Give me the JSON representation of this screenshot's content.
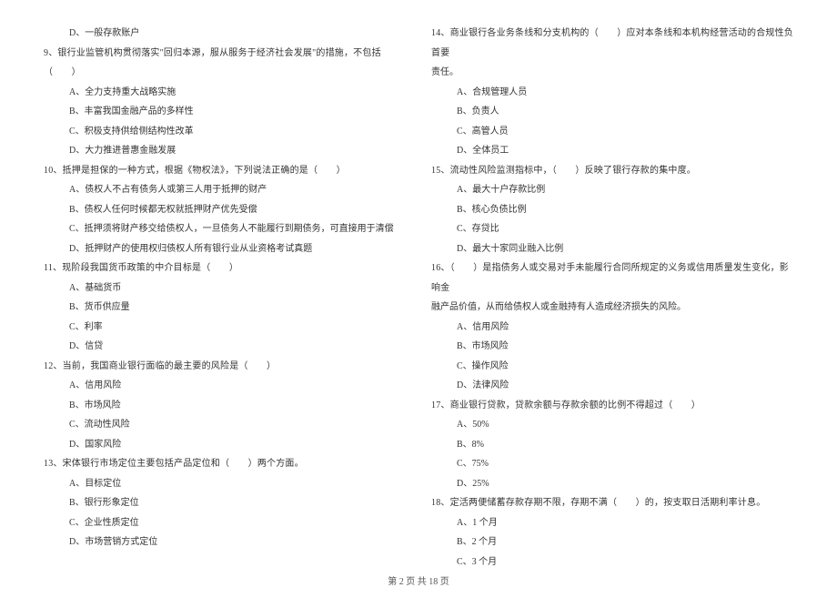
{
  "leftCol": {
    "preOption": "D、一般存款账户",
    "questions": [
      {
        "num": "9、",
        "text": "银行业监管机构贯彻落实\"回归本源，服从服务于经济社会发展\"的措施，不包括（　　）",
        "options": [
          "A、全力支持重大战略实施",
          "B、丰富我国金融产品的多样性",
          "C、积极支持供给侧结构性改革",
          "D、大力推进普惠金融发展"
        ]
      },
      {
        "num": "10、",
        "text": "抵押是担保的一种方式，根据《物权法》，下列说法正确的是（　　）",
        "options": [
          "A、债权人不占有债务人或第三人用于抵押的财产",
          "B、债权人任何时候都无权就抵押财产优先受偿",
          "C、抵押须将财产移交给债权人，一旦债务人不能履行到期债务，可直接用于清偿",
          "D、抵押财产的使用权归债权人所有银行业从业资格考试真题"
        ]
      },
      {
        "num": "11、",
        "text": "现阶段我国货币政策的中介目标是（　　）",
        "options": [
          "A、基础货币",
          "B、货币供应量",
          "C、利率",
          "D、信贷"
        ]
      },
      {
        "num": "12、",
        "text": "当前，我国商业银行面临的最主要的风险是（　　）",
        "options": [
          "A、信用风险",
          "B、市场风险",
          "C、流动性风险",
          "D、国家风险"
        ]
      },
      {
        "num": "13、",
        "text": "宋体银行市场定位主要包括产品定位和（　　）两个方面。",
        "options": [
          "A、目标定位",
          "B、银行形象定位",
          "C、企业性质定位",
          "D、市场营销方式定位"
        ]
      }
    ]
  },
  "rightCol": {
    "questions": [
      {
        "num": "14、",
        "text": "商业银行各业务条线和分支机构的（　　）应对本条线和本机构经营活动的合规性负首要",
        "cont": "责任。",
        "options": [
          "A、合规管理人员",
          "B、负责人",
          "C、高管人员",
          "D、全体员工"
        ]
      },
      {
        "num": "15、",
        "text": "流动性风险监测指标中，（　　）反映了银行存款的集中度。",
        "options": [
          "A、最大十户存款比例",
          "B、核心负债比例",
          "C、存贷比",
          "D、最大十家同业融入比例"
        ]
      },
      {
        "num": "16、",
        "text": "（　　）是指债务人或交易对手未能履行合同所规定的义务或信用质量发生变化，影响金",
        "cont": "融产品价值，从而给债权人或金融持有人造成经济损失的风险。",
        "options": [
          "A、信用风险",
          "B、市场风险",
          "C、操作风险",
          "D、法律风险"
        ]
      },
      {
        "num": "17、",
        "text": "商业银行贷款，贷款余额与存款余额的比例不得超过（　　）",
        "options": [
          "A、50%",
          "B、8%",
          "C、75%",
          "D、25%"
        ]
      },
      {
        "num": "18、",
        "text": "定活两便储蓄存款存期不限，存期不满（　　）的，按支取日活期利率计息。",
        "options": [
          "A、1 个月",
          "B、2 个月",
          "C、3 个月"
        ]
      }
    ]
  },
  "footer": "第 2 页 共 18 页"
}
